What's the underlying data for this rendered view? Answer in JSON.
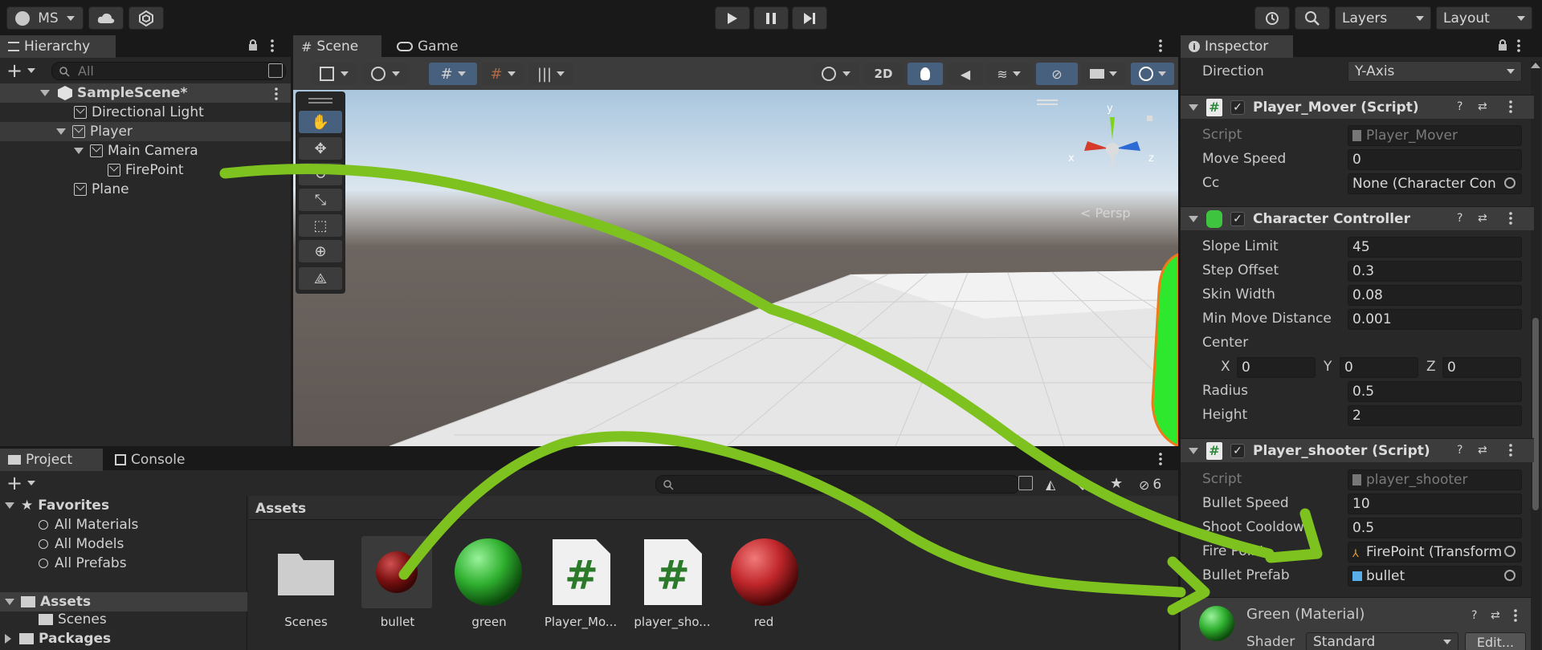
{
  "toolbar": {
    "account": "MS",
    "layers": "Layers",
    "layout": "Layout"
  },
  "hierarchy": {
    "tab": "Hierarchy",
    "search_placeholder": "All",
    "scene": "SampleScene*",
    "items": [
      "Directional Light",
      "Player",
      "Main Camera",
      "FirePoint",
      "Plane"
    ]
  },
  "scene": {
    "tab_scene": "Scene",
    "tab_game": "Game",
    "btn_2d": "2D",
    "gizmo_y": "y",
    "gizmo_x": "x",
    "gizmo_z": "z",
    "persp": "< Persp"
  },
  "inspector": {
    "tab": "Inspector",
    "direction_label": "Direction",
    "direction_value": "Y-Axis",
    "player_mover": {
      "title": "Player_Mover (Script)",
      "script_label": "Script",
      "script_value": "Player_Mover",
      "move_speed_label": "Move Speed",
      "move_speed_value": "0",
      "cc_label": "Cc",
      "cc_value": "None (Character Con"
    },
    "character_controller": {
      "title": "Character Controller",
      "slope_limit_label": "Slope Limit",
      "slope_limit_value": "45",
      "step_offset_label": "Step Offset",
      "step_offset_value": "0.3",
      "skin_width_label": "Skin Width",
      "skin_width_value": "0.08",
      "min_move_label": "Min Move Distance",
      "min_move_value": "0.001",
      "center_label": "Center",
      "x_label": "X",
      "x_value": "0",
      "y_label": "Y",
      "y_value": "0",
      "z_label": "Z",
      "z_value": "0",
      "radius_label": "Radius",
      "radius_value": "0.5",
      "height_label": "Height",
      "height_value": "2"
    },
    "player_shooter": {
      "title": "Player_shooter (Script)",
      "script_label": "Script",
      "script_value": "player_shooter",
      "bullet_speed_label": "Bullet Speed",
      "bullet_speed_value": "10",
      "shoot_cooldown_label": "Shoot Cooldown",
      "shoot_cooldown_value": "0.5",
      "fire_point_label": "Fire Point",
      "fire_point_value": "FirePoint (Transform",
      "bullet_prefab_label": "Bullet Prefab",
      "bullet_prefab_value": "bullet"
    },
    "material": {
      "title": "Green (Material)",
      "shader_label": "Shader",
      "shader_value": "Standard",
      "edit": "Edit..."
    }
  },
  "project": {
    "tab_project": "Project",
    "tab_console": "Console",
    "hidden_count": "6",
    "favorites": "Favorites",
    "fav_items": [
      "All Materials",
      "All Models",
      "All Prefabs"
    ],
    "assets": "Assets",
    "scenes": "Scenes",
    "packages": "Packages",
    "breadcrumb": "Assets",
    "asset_items": [
      "Scenes",
      "bullet",
      "green",
      "Player_Mo...",
      "player_sho...",
      "red"
    ]
  },
  "colors": {
    "annotation_arrow": "#7dc21e",
    "accent_blue": "#3a79bb",
    "green_material": "#2fb02f",
    "red_material": "#c0262a"
  }
}
